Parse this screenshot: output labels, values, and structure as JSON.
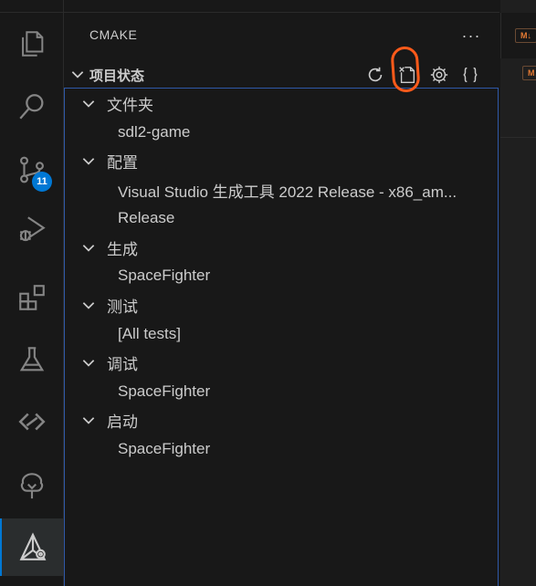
{
  "activity_bar": {
    "items": [
      {
        "name": "explorer-icon"
      },
      {
        "name": "search-icon"
      },
      {
        "name": "source-control-icon",
        "badge": "11"
      },
      {
        "name": "run-debug-icon"
      },
      {
        "name": "extensions-icon"
      },
      {
        "name": "testing-icon"
      },
      {
        "name": "remote-icon"
      },
      {
        "name": "tree-icon"
      },
      {
        "name": "cmake-icon",
        "active": true
      }
    ]
  },
  "sidebar": {
    "title": "CMAKE",
    "more": "···",
    "section": {
      "title": "项目状态",
      "actions": [
        "refresh-icon",
        "delete-cache-icon",
        "settings-icon",
        "braces-icon"
      ]
    },
    "tree": [
      {
        "label": "文件夹",
        "children": [
          "sdl2-game"
        ]
      },
      {
        "label": "配置",
        "children": [
          "Visual Studio 生成工具 2022 Release - x86_am...",
          "Release"
        ]
      },
      {
        "label": "生成",
        "children": [
          "SpaceFighter"
        ]
      },
      {
        "label": "测试",
        "children": [
          "[All tests]"
        ]
      },
      {
        "label": "调试",
        "children": [
          "SpaceFighter"
        ]
      },
      {
        "label": "启动",
        "children": [
          "SpaceFighter"
        ]
      }
    ]
  },
  "editor": {
    "tab_icon_label": "M↓"
  },
  "colors": {
    "accent": "#0078d4",
    "annotation": "#ff5a1a",
    "text": "#cccccc"
  }
}
